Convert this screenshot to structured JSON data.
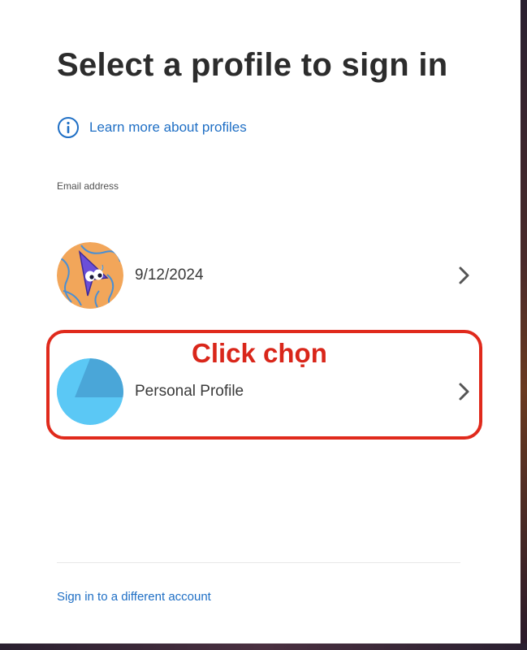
{
  "dialog": {
    "title": "Select a profile to sign in",
    "learn_more": {
      "icon": "info-icon",
      "label": "Learn more about profiles"
    },
    "email_label": "Email address",
    "profiles": [
      {
        "label": "9/12/2024",
        "avatar": "cursor-character-avatar",
        "chevron": "chevron-right-icon"
      },
      {
        "label": "Personal Profile",
        "avatar": "personal-profile-avatar",
        "chevron": "chevron-right-icon"
      }
    ],
    "annotation": "Click chọn",
    "different_account": "Sign in to a different account"
  },
  "colors": {
    "link": "#1f6fc5",
    "title": "#2c2c2c",
    "highlight": "#e02a1c",
    "avatar_orange": "#f2a65a",
    "avatar_blue": "#5bc8f5"
  }
}
